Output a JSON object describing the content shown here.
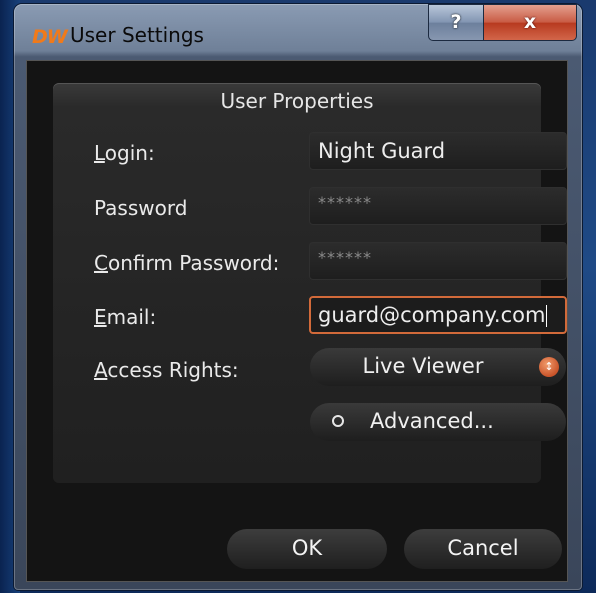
{
  "window": {
    "logo": "DW",
    "title": "User Settings",
    "help_label": "?",
    "close_label": "x"
  },
  "group": {
    "title": "User Properties"
  },
  "form": {
    "login": {
      "label_accel": "L",
      "label_rest": "ogin:",
      "value": "Night Guard"
    },
    "password": {
      "label": "Password",
      "value": "******"
    },
    "confirm_password": {
      "label_accel": "C",
      "label_rest": "onfirm Password:",
      "value": "******"
    },
    "email": {
      "label_accel": "E",
      "label_rest": "mail:",
      "value": "guard@company.com"
    },
    "access_rights": {
      "label_accel": "A",
      "label_rest": "ccess Rights:",
      "selected": "Live Viewer"
    },
    "advanced_label": "Advanced..."
  },
  "buttons": {
    "ok": "OK",
    "cancel": "Cancel"
  },
  "icons": {
    "combo_arrow": "spinner-updown-icon",
    "advanced": "circle-icon"
  },
  "colors": {
    "logo": "#f07a1a",
    "focus_border": "#d26a3a",
    "combo_arrow": "#c9542a",
    "close_button": "#c85a43"
  }
}
